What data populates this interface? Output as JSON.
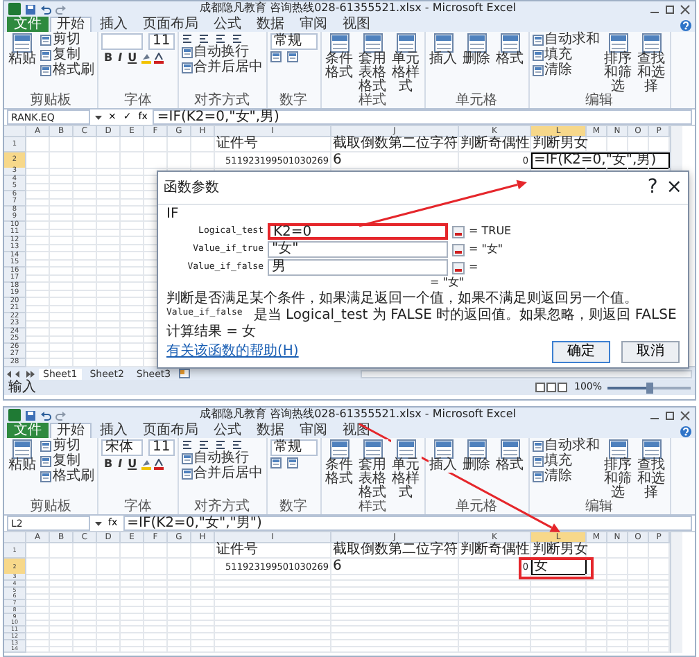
{
  "panels": [
    {
      "title_bar": {
        "title": "成都隐凡教育 咨询热线028-61355521.xlsx - Microsoft Excel"
      },
      "tabs": [
        {
          "label": "文件",
          "kind": "file",
          "selected": false
        },
        {
          "label": "开始",
          "kind": "tab",
          "selected": true
        },
        {
          "label": "插入",
          "kind": "tab",
          "selected": false
        },
        {
          "label": "页面布局",
          "kind": "tab",
          "selected": false
        },
        {
          "label": "公式",
          "kind": "tab",
          "selected": false
        },
        {
          "label": "数据",
          "kind": "tab",
          "selected": false
        },
        {
          "label": "审阅",
          "kind": "tab",
          "selected": false
        },
        {
          "label": "视图",
          "kind": "tab",
          "selected": false
        }
      ],
      "ribbon": [
        {
          "label": "剪贴板",
          "items": [
            {
              "kind": "big",
              "label": "粘贴"
            },
            {
              "kind": "small",
              "label": "剪切"
            },
            {
              "kind": "small",
              "label": "复制"
            },
            {
              "kind": "small",
              "label": "格式刷"
            }
          ]
        },
        {
          "label": "字体",
          "items": [
            {
              "kind": "font",
              "size": "11"
            },
            {
              "kind": "format",
              "labels": [
                "B",
                "I",
                "U"
              ]
            }
          ]
        },
        {
          "label": "对齐方式",
          "items": [
            {
              "kind": "align"
            },
            {
              "kind": "small",
              "label": "自动换行"
            },
            {
              "kind": "small",
              "label": "合并后居中"
            }
          ]
        },
        {
          "label": "数字",
          "items": [
            {
              "kind": "field",
              "value": "常规"
            },
            {
              "kind": "numicons"
            }
          ]
        },
        {
          "label": "样式",
          "items": [
            {
              "kind": "big",
              "label": "条件格式"
            },
            {
              "kind": "big",
              "label": "套用表格格式"
            },
            {
              "kind": "big",
              "label": "单元格样式"
            }
          ]
        },
        {
          "label": "单元格",
          "items": [
            {
              "kind": "big",
              "label": "插入"
            },
            {
              "kind": "big",
              "label": "删除"
            },
            {
              "kind": "big",
              "label": "格式"
            }
          ]
        },
        {
          "label": "编辑",
          "items": [
            {
              "kind": "small",
              "label": "自动求和"
            },
            {
              "kind": "small",
              "label": "填充"
            },
            {
              "kind": "small",
              "label": "清除"
            },
            {
              "kind": "big",
              "label": "排序和筛选"
            },
            {
              "kind": "big",
              "label": "查找和选择"
            }
          ]
        }
      ],
      "formula_bar": {
        "name_box": "RANK.EQ",
        "buttons": [
          "×",
          "✓",
          "fx"
        ],
        "formula": "=IF(K2=0,\"女\",男)"
      },
      "grid": {
        "columns": [
          {
            "label": "A",
            "selected": false
          },
          {
            "label": "B",
            "selected": false
          },
          {
            "label": "C",
            "selected": false
          },
          {
            "label": "D",
            "selected": false
          },
          {
            "label": "E",
            "selected": false
          },
          {
            "label": "F",
            "selected": false
          },
          {
            "label": "G",
            "selected": false
          },
          {
            "label": "H",
            "selected": false
          },
          {
            "label": "I",
            "selected": false
          },
          {
            "label": "J",
            "selected": false
          },
          {
            "label": "K",
            "selected": false
          },
          {
            "label": "L",
            "selected": true
          },
          {
            "label": "M",
            "selected": false
          },
          {
            "label": "N",
            "selected": false
          },
          {
            "label": "O",
            "selected": false
          },
          {
            "label": "P",
            "selected": false
          }
        ],
        "rows": [
          {
            "label": "1",
            "selected": false,
            "cells": [
              null,
              null,
              null,
              null,
              null,
              null,
              null,
              null,
              {
                "text": "证件号"
              },
              {
                "text": "截取倒数第二位字符"
              },
              {
                "text": "判断奇偶性"
              },
              {
                "text": "判断男女"
              },
              null,
              null,
              null,
              null
            ]
          },
          {
            "label": "2",
            "selected": true,
            "cells": [
              null,
              null,
              null,
              null,
              null,
              null,
              null,
              null,
              {
                "text": "511923199501030269",
                "kind": "number"
              },
              {
                "text": "6"
              },
              {
                "text": "0",
                "kind": "number",
                "arrow_target": true
              },
              {
                "text": "=IF(K2=0,\"女\",男)",
                "active": true,
                "editing": true
              },
              null,
              null,
              null,
              null
            ]
          },
          {
            "label": "3",
            "selected": false
          },
          {
            "label": "4",
            "selected": false
          },
          {
            "label": "5",
            "selected": false
          },
          {
            "label": "6",
            "selected": false
          },
          {
            "label": "7",
            "selected": false
          },
          {
            "label": "8",
            "selected": false
          },
          {
            "label": "9",
            "selected": false
          },
          {
            "label": "10",
            "selected": false
          },
          {
            "label": "11",
            "selected": false
          },
          {
            "label": "12",
            "selected": false
          },
          {
            "label": "13",
            "selected": false
          },
          {
            "label": "14",
            "selected": false
          },
          {
            "label": "15",
            "selected": false
          },
          {
            "label": "16",
            "selected": false
          },
          {
            "label": "17",
            "selected": false
          },
          {
            "label": "18",
            "selected": false
          },
          {
            "label": "19",
            "selected": false
          },
          {
            "label": "20",
            "selected": false
          },
          {
            "label": "21",
            "selected": false
          },
          {
            "label": "22",
            "selected": false
          },
          {
            "label": "23",
            "selected": false
          },
          {
            "label": "24",
            "selected": false
          },
          {
            "label": "25",
            "selected": false
          },
          {
            "label": "26",
            "selected": false
          },
          {
            "label": "27",
            "selected": false
          },
          {
            "label": "28",
            "selected": false
          }
        ]
      },
      "dialog": {
        "title": "函数参数",
        "help": "?",
        "close": "×",
        "function": "IF",
        "args": [
          {
            "name": "Logical_test",
            "value": "K2=0",
            "result": "= TRUE",
            "highlighted": true
          },
          {
            "name": "Value_if_true",
            "value": "\"女\"",
            "result": "= \"女\"",
            "highlighted": false
          },
          {
            "name": "Value_if_false",
            "value": "男",
            "result": "=",
            "highlighted": false
          }
        ],
        "overall": "= \"女\"",
        "description": "判断是否满足某个条件，如果满足返回一个值，如果不满足则返回另一个值。",
        "arg_name": "Value_if_false",
        "arg_help": "是当 Logical_test 为 FALSE 时的返回值。如果忽略，则返回 FALSE",
        "result": "计算结果 = 女",
        "help_link": "有关该函数的帮助(H)",
        "buttons": [
          {
            "label": "确定",
            "default": true
          },
          {
            "label": "取消",
            "default": false
          }
        ]
      },
      "sheet_tabs": [
        {
          "label": "Sheet1",
          "selected": true
        },
        {
          "label": "Sheet2",
          "selected": false
        },
        {
          "label": "Sheet3",
          "selected": false
        }
      ],
      "status_bar": {
        "mode": "输入",
        "zoom": "100%",
        "level": 0.5
      }
    },
    {
      "title_bar": {
        "title": "成都隐凡教育 咨询热线028-61355521.xlsx - Microsoft Excel"
      },
      "tabs": [
        {
          "label": "文件",
          "kind": "file",
          "selected": false
        },
        {
          "label": "开始",
          "kind": "tab",
          "selected": true
        },
        {
          "label": "插入",
          "kind": "tab",
          "selected": false
        },
        {
          "label": "页面布局",
          "kind": "tab",
          "selected": false
        },
        {
          "label": "公式",
          "kind": "tab",
          "selected": false
        },
        {
          "label": "数据",
          "kind": "tab",
          "selected": false
        },
        {
          "label": "审阅",
          "kind": "tab",
          "selected": false
        },
        {
          "label": "视图",
          "kind": "tab",
          "selected": false
        }
      ],
      "ribbon": [
        {
          "label": "剪贴板",
          "items": [
            {
              "kind": "big",
              "label": "粘贴"
            },
            {
              "kind": "small",
              "label": "剪切"
            },
            {
              "kind": "small",
              "label": "复制"
            },
            {
              "kind": "small",
              "label": "格式刷"
            }
          ]
        },
        {
          "label": "字体",
          "items": [
            {
              "kind": "font",
              "value": "宋体",
              "size": "11"
            },
            {
              "kind": "format",
              "labels": [
                "B",
                "I",
                "U"
              ]
            }
          ]
        },
        {
          "label": "对齐方式",
          "items": [
            {
              "kind": "align"
            },
            {
              "kind": "small",
              "label": "自动换行"
            },
            {
              "kind": "small",
              "label": "合并后居中"
            }
          ]
        },
        {
          "label": "数字",
          "items": [
            {
              "kind": "field",
              "value": "常规"
            },
            {
              "kind": "numicons"
            }
          ]
        },
        {
          "label": "样式",
          "items": [
            {
              "kind": "big",
              "label": "条件格式"
            },
            {
              "kind": "big",
              "label": "套用表格格式"
            },
            {
              "kind": "big",
              "label": "单元格样式"
            }
          ]
        },
        {
          "label": "单元格",
          "items": [
            {
              "kind": "big",
              "label": "插入"
            },
            {
              "kind": "big",
              "label": "删除"
            },
            {
              "kind": "big",
              "label": "格式"
            }
          ]
        },
        {
          "label": "编辑",
          "items": [
            {
              "kind": "small",
              "label": "自动求和"
            },
            {
              "kind": "small",
              "label": "填充"
            },
            {
              "kind": "small",
              "label": "清除"
            },
            {
              "kind": "big",
              "label": "排序和筛选"
            },
            {
              "kind": "big",
              "label": "查找和选择"
            }
          ]
        }
      ],
      "formula_bar": {
        "name_box": "L2",
        "buttons": [
          "fx"
        ],
        "formula": "=IF(K2=0,\"女\",\"男\")"
      },
      "grid": {
        "columns": [
          {
            "label": "A",
            "selected": false
          },
          {
            "label": "B",
            "selected": false
          },
          {
            "label": "C",
            "selected": false
          },
          {
            "label": "D",
            "selected": false
          },
          {
            "label": "E",
            "selected": false
          },
          {
            "label": "F",
            "selected": false
          },
          {
            "label": "G",
            "selected": false
          },
          {
            "label": "H",
            "selected": false
          },
          {
            "label": "I",
            "selected": false
          },
          {
            "label": "J",
            "selected": false
          },
          {
            "label": "K",
            "selected": false
          },
          {
            "label": "L",
            "selected": true,
            "arrow_target": true
          },
          {
            "label": "M",
            "selected": false
          },
          {
            "label": "N",
            "selected": false
          },
          {
            "label": "O",
            "selected": false
          },
          {
            "label": "P",
            "selected": false
          }
        ],
        "rows": [
          {
            "label": "1",
            "selected": false,
            "cells": [
              null,
              null,
              null,
              null,
              null,
              null,
              null,
              null,
              {
                "text": "证件号"
              },
              {
                "text": "截取倒数第二位字符"
              },
              {
                "text": "判断奇偶性"
              },
              {
                "text": "判断男女"
              },
              null,
              null,
              null,
              null
            ]
          },
          {
            "label": "2",
            "selected": true,
            "cells": [
              null,
              null,
              null,
              null,
              null,
              null,
              null,
              null,
              {
                "text": "511923199501030269",
                "kind": "number"
              },
              {
                "text": "6"
              },
              {
                "text": "0",
                "kind": "number"
              },
              {
                "text": "女",
                "active": true,
                "highlighted": true
              },
              null,
              null,
              null,
              null
            ]
          },
          {
            "label": "3",
            "selected": false
          },
          {
            "label": "4",
            "selected": false
          },
          {
            "label": "5",
            "selected": false
          },
          {
            "label": "6",
            "selected": false
          },
          {
            "label": "7",
            "selected": false
          },
          {
            "label": "8",
            "selected": false
          },
          {
            "label": "9",
            "selected": false
          },
          {
            "label": "10",
            "selected": false
          },
          {
            "label": "11",
            "selected": false
          },
          {
            "label": "12",
            "selected": false
          },
          {
            "label": "13",
            "selected": false
          },
          {
            "label": "14",
            "selected": false
          }
        ]
      }
    }
  ]
}
